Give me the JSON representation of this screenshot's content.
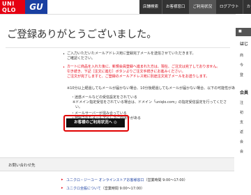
{
  "header": {
    "logo_uniqlo_line1": "UNI",
    "logo_uniqlo_line2": "QLO",
    "logo_gu": "GU",
    "nav": [
      "店舗検索",
      "お客様窓口",
      "ご利用状況",
      "ログアウト",
      "カ"
    ]
  },
  "page_title": "ご登録ありがとうございました。",
  "notice": {
    "line1": "ご入力いただいたメールアドレス宛に登録完了メールを送信させていただきます。",
    "line2": "ご確認ください。",
    "red_line1": "カートに商品を入れた後に、新規会員登録へ進まれた方は、現在、ご注文は完了しておりません。",
    "red_line2": "引き続き、下記［注文に進む］ボタンよりご注文手続きにお進みください。",
    "red_line3": "ご注文が完了しますと、ご登録のメールアドレス宛に別途注文完了メールをお送りします。",
    "note1": "※10分以上経過してもメールが届かない場合、10分後経過してもメールが届かない場合、以下の可能性があります。",
    "cause1": "・迷惑メールなどの受信設定をされている",
    "cause1_sub1": "※ドメイン指定受信をされている場合は、ドメイン「uniqlo.com」の指定受信設定を行ってくださ",
    "cause1_sub2": "い。",
    "cause2": "・メールサーバーが混み合っている",
    "cause3": "・登録されたメールアドレスに間違いがある"
  },
  "button_label": "お客様のご利用状況へ ◎",
  "inquiry": {
    "title": "お問い合わせ先",
    "link1": "ユニクロ・ジーユー オンラインストアお客様窓口",
    "link1_time": "（営業時間 9:00～17:00）",
    "link2": "ユニクロ全般について",
    "link2_time": "（営業時間 9:00～17:00）"
  },
  "sidebar": {
    "head": "■",
    "items": [
      "はじ",
      "商",
      "今",
      "登",
      "会員",
      "注",
      "初",
      "支",
      "返",
      "会",
      "会"
    ]
  },
  "colors": {
    "brand_red": "#e60012",
    "gu_blue": "#1a3fa1",
    "nav_bg": "#333333"
  }
}
